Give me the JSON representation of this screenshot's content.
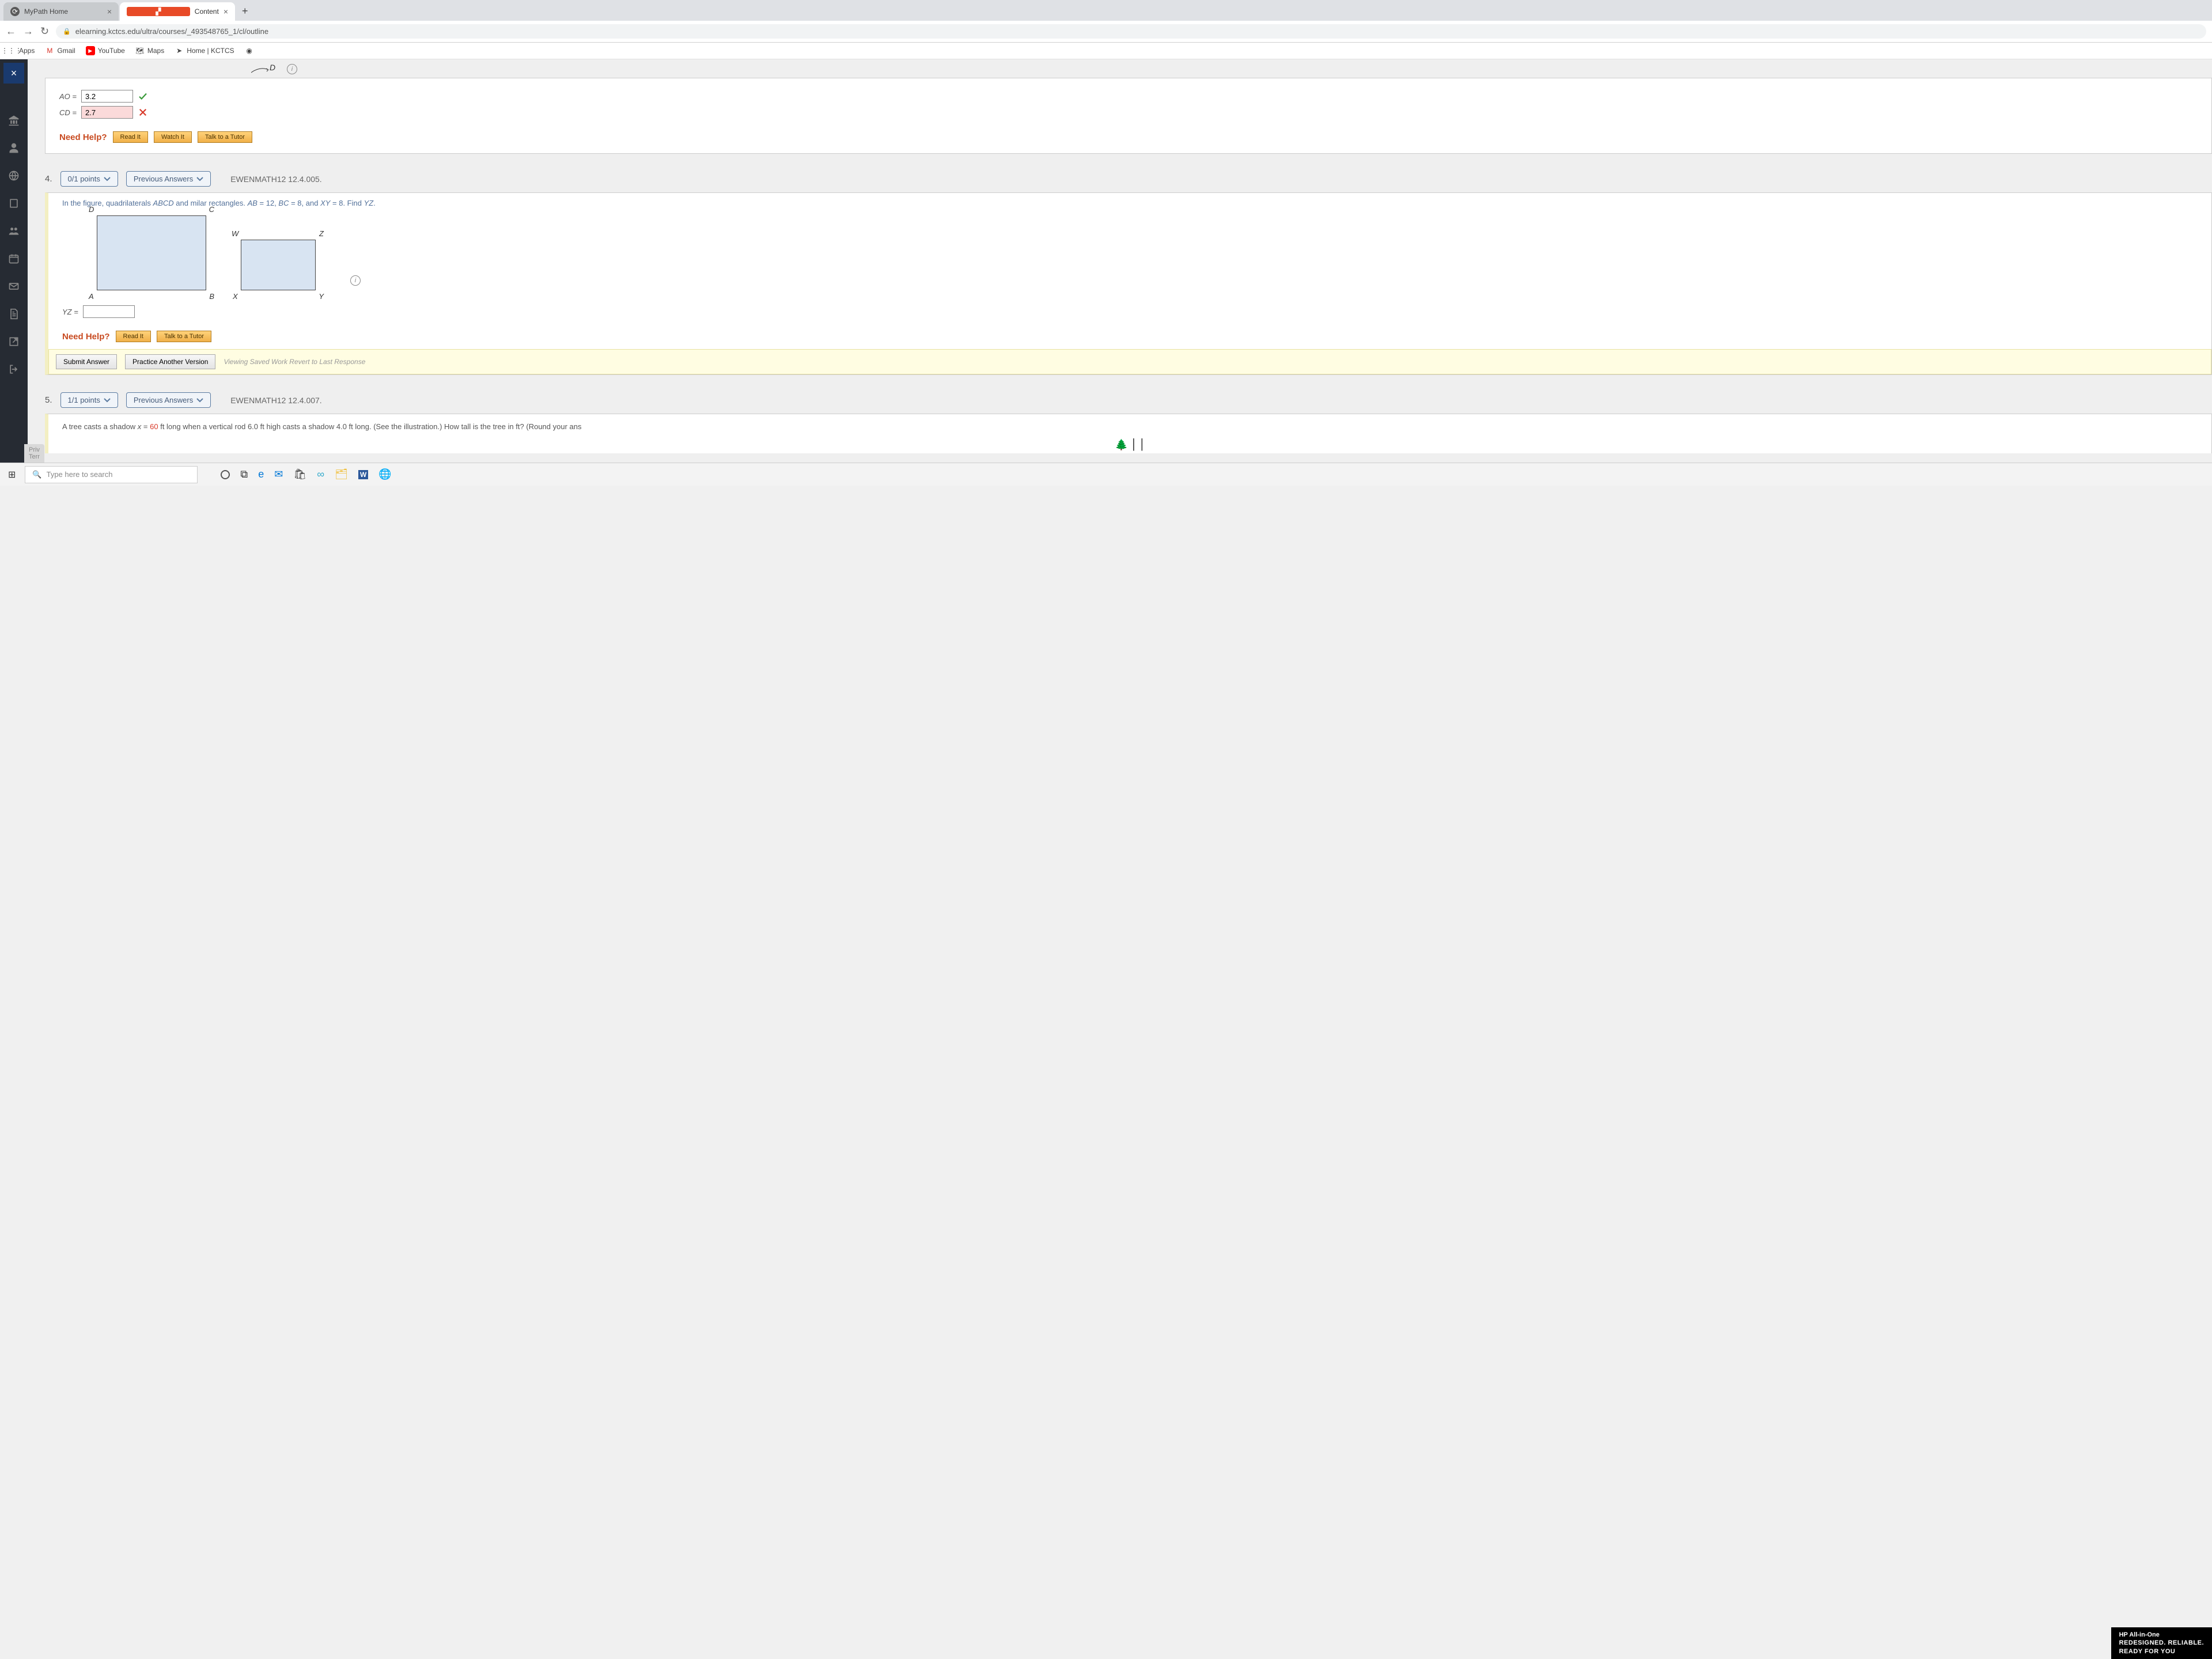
{
  "tabs": {
    "t0": {
      "label": "MyPath Home"
    },
    "t1": {
      "label": "Content"
    }
  },
  "url": "elearning.kctcs.edu/ultra/courses/_493548765_1/cl/outline",
  "bookmarks": {
    "apps": "Apps",
    "gmail": "Gmail",
    "youtube": "YouTube",
    "maps": "Maps",
    "home": "Home | KCTCS"
  },
  "q3": {
    "ao_label": "AO  =",
    "ao_val": "3.2",
    "cd_label": "CD  =",
    "cd_val": "2.7",
    "needhelp": "Need Help?",
    "read": "Read It",
    "watch": "Watch It",
    "tutor": "Talk to a Tutor"
  },
  "q4": {
    "num": "4.",
    "points": "0/1 points",
    "prev": "Previous Answers",
    "ref": "EWENMATH12 12.4.005.",
    "text_a": "In the figure, quadrilaterals ",
    "abcd": "ABCD",
    "text_b": " and ",
    "text_gap": "          ",
    "text_c": "milar rectangles. ",
    "ab": "AB",
    "eq1": " = 12, ",
    "bc": "BC",
    "eq2": " = 8, and ",
    "xy": "XY",
    "eq3": " = 8. Find ",
    "yz": "YZ",
    "dot": ".",
    "rectABCD": {
      "D": "D",
      "C": "C",
      "A": "A",
      "B": "B"
    },
    "rectWXYZ": {
      "W": "W",
      "Z": "Z",
      "X": "X",
      "Y": "Y"
    },
    "yz_label": "YZ =",
    "needhelp": "Need Help?",
    "read": "Read It",
    "tutor": "Talk to a Tutor",
    "submit": "Submit Answer",
    "practice": "Practice Another Version",
    "saved": "Viewing Saved Work Revert to Last Response"
  },
  "q5": {
    "num": "5.",
    "points": "1/1 points",
    "prev": "Previous Answers",
    "ref": "EWENMATH12 12.4.007.",
    "text_a": "A tree casts a shadow ",
    "x": "x",
    "text_b": " = ",
    "val": "60",
    "text_c": " ft long when a vertical rod 6.0 ft high casts a shadow 4.0 ft long. (See the illustration.) How tall is the tree in ft? (Round your ans"
  },
  "footer": {
    "priv": "Priv",
    "terr": "Terr"
  },
  "taskbar": {
    "search": "Type here to search"
  },
  "hp": {
    "l1": "HP All-in-One",
    "l2": "REDESIGNED. RELIABLE.",
    "l3": "READY FOR YOU"
  },
  "topd": {
    "D": "D"
  }
}
